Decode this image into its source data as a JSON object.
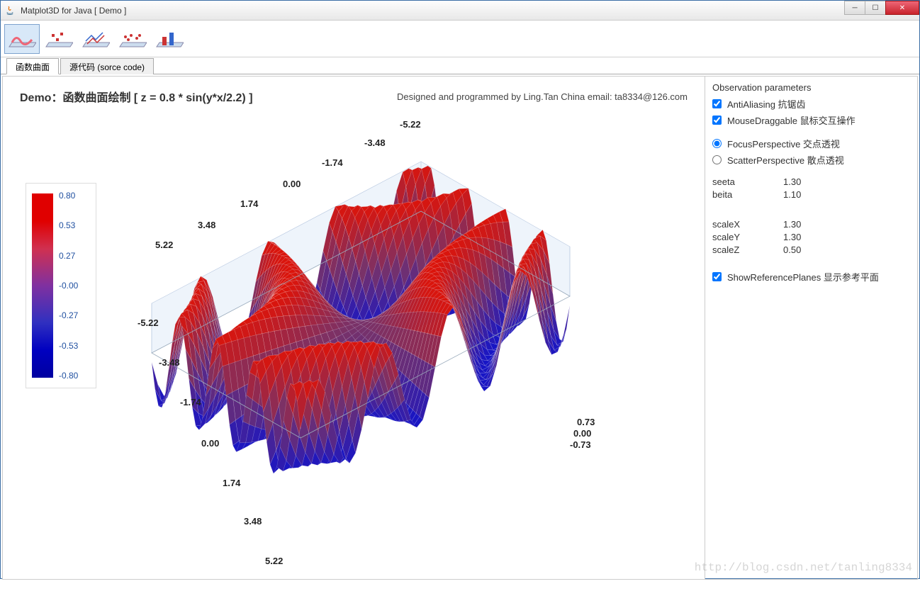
{
  "window": {
    "title": "Matplot3D for Java  [ Demo ]"
  },
  "toolbar": {
    "buttons": [
      "surface-wave",
      "scatter-cube",
      "line-3d",
      "scatter-flat",
      "bar-3d"
    ]
  },
  "tabs": [
    {
      "label": "函数曲面",
      "active": true
    },
    {
      "label": "源代码   (sorce code)",
      "active": false
    }
  ],
  "chart": {
    "title": "Demo：函数曲面绘制   [ z =  0.8 * sin(y*x/2.2) ]",
    "credit": "Designed and programmed by Ling.Tan China   email: ta8334@126.com"
  },
  "colorbar": {
    "ticks": [
      "0.80",
      "0.53",
      "0.27",
      "-0.00",
      "-0.27",
      "-0.53",
      "-0.80"
    ]
  },
  "side": {
    "title": "Observation parameters",
    "antialiasing": "AntiAliasing  抗锯齿",
    "mousedrag": "MouseDraggable  鼠标交互操作",
    "focus": "FocusPerspective  交点透视",
    "scatter": "ScatterPerspective  散点透视",
    "params": [
      {
        "label": "seeta",
        "value": "1.30"
      },
      {
        "label": "beita",
        "value": "1.10"
      }
    ],
    "scales": [
      {
        "label": "scaleX",
        "value": "1.30"
      },
      {
        "label": "scaleY",
        "value": "1.30"
      },
      {
        "label": "scaleZ",
        "value": "0.50"
      }
    ],
    "showref": "ShowReferencePlanes  显示参考平面"
  },
  "axes": {
    "top": [
      "-5.22",
      "-3.48",
      "-1.74",
      "0.00",
      "1.74",
      "3.48",
      "5.22"
    ],
    "left": [
      "-5.22",
      "-3.48",
      "-1.74",
      "0.00",
      "1.74",
      "3.48",
      "5.22"
    ],
    "z": [
      "0.73",
      "0.00",
      "-0.73"
    ]
  },
  "watermark": "http://blog.csdn.net/tanling8334",
  "chart_data": {
    "type": "surface",
    "title": "z = 0.8 * sin(y*x/2.2)",
    "x_range": [
      -5.22,
      5.22
    ],
    "y_range": [
      -5.22,
      5.22
    ],
    "z_range": [
      -0.8,
      0.8
    ],
    "x_ticks": [
      -5.22,
      -3.48,
      -1.74,
      0.0,
      1.74,
      3.48,
      5.22
    ],
    "y_ticks": [
      -5.22,
      -3.48,
      -1.74,
      0.0,
      1.74,
      3.48,
      5.22
    ],
    "z_ticks": [
      -0.73,
      0.0,
      0.73
    ],
    "formula": "0.8*sin(x*y/2.2)",
    "colormap": "blue-red",
    "colorbar_ticks": [
      0.8,
      0.53,
      0.27,
      -0.0,
      -0.27,
      -0.53,
      -0.8
    ]
  }
}
